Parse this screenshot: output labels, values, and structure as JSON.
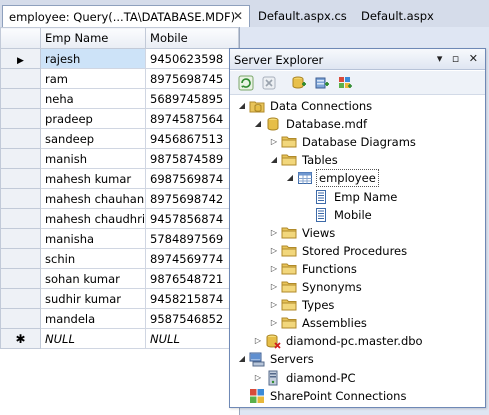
{
  "tabs": [
    {
      "label": "employee: Query(...TA\\DATABASE.MDF)",
      "active": true
    },
    {
      "label": "Default.aspx.cs",
      "active": false
    },
    {
      "label": "Default.aspx",
      "active": false
    }
  ],
  "tab_close_glyph": "✕",
  "grid": {
    "columns": [
      "Emp Name",
      "Mobile"
    ],
    "rows": [
      {
        "name": "rajesh",
        "mobile": "9450623598"
      },
      {
        "name": "ram",
        "mobile": "8975698745"
      },
      {
        "name": "neha",
        "mobile": "5689745895"
      },
      {
        "name": "pradeep",
        "mobile": "8974587564"
      },
      {
        "name": "sandeep",
        "mobile": "9456867513"
      },
      {
        "name": "manish",
        "mobile": "9875874589"
      },
      {
        "name": "mahesh kumar",
        "mobile": "6987569874"
      },
      {
        "name": "mahesh chauhan",
        "mobile": "8975698742"
      },
      {
        "name": "mahesh chaudhri",
        "mobile": "9457856874"
      },
      {
        "name": "manisha",
        "mobile": "5784897569"
      },
      {
        "name": "schin",
        "mobile": "8974569774"
      },
      {
        "name": "sohan kumar",
        "mobile": "9876548721"
      },
      {
        "name": "sudhir kumar",
        "mobile": "9458215874"
      },
      {
        "name": "mandela",
        "mobile": "9587546852"
      }
    ],
    "new_row": {
      "name": "NULL",
      "mobile": "NULL"
    },
    "current_row_glyph": "▶",
    "new_row_glyph": "✱"
  },
  "server_explorer": {
    "title": "Server Explorer",
    "title_buttons": "▾ ▫ ✕",
    "toolbar": [
      "refresh-icon",
      "stop-icon",
      "connect-to-database-icon",
      "connect-to-server-icon",
      "connect-to-sharepoint-icon"
    ],
    "tree": [
      {
        "label": "Data Connections",
        "depth": 0,
        "expander": "expanded",
        "icon": "data-connections-icon"
      },
      {
        "label": "Database.mdf",
        "depth": 1,
        "expander": "expanded",
        "icon": "database-icon"
      },
      {
        "label": "Database Diagrams",
        "depth": 2,
        "expander": "collapsed",
        "icon": "folder-icon"
      },
      {
        "label": "Tables",
        "depth": 2,
        "expander": "expanded",
        "icon": "folder-icon"
      },
      {
        "label": "employee",
        "depth": 3,
        "expander": "expanded",
        "icon": "table-icon",
        "boxed": true
      },
      {
        "label": "Emp Name",
        "depth": 4,
        "expander": "none",
        "icon": "column-icon"
      },
      {
        "label": "Mobile",
        "depth": 4,
        "expander": "none",
        "icon": "column-icon"
      },
      {
        "label": "Views",
        "depth": 2,
        "expander": "collapsed",
        "icon": "folder-icon"
      },
      {
        "label": "Stored Procedures",
        "depth": 2,
        "expander": "collapsed",
        "icon": "folder-icon"
      },
      {
        "label": "Functions",
        "depth": 2,
        "expander": "collapsed",
        "icon": "folder-icon"
      },
      {
        "label": "Synonyms",
        "depth": 2,
        "expander": "collapsed",
        "icon": "folder-icon"
      },
      {
        "label": "Types",
        "depth": 2,
        "expander": "collapsed",
        "icon": "folder-icon"
      },
      {
        "label": "Assemblies",
        "depth": 2,
        "expander": "collapsed",
        "icon": "folder-icon"
      },
      {
        "label": "diamond-pc.master.dbo",
        "depth": 1,
        "expander": "collapsed",
        "icon": "database-disconnected-icon"
      },
      {
        "label": "Servers",
        "depth": 0,
        "expander": "expanded",
        "icon": "servers-icon"
      },
      {
        "label": "diamond-PC",
        "depth": 1,
        "expander": "collapsed",
        "icon": "server-icon"
      },
      {
        "label": "SharePoint Connections",
        "depth": 0,
        "expander": "none",
        "icon": "sharepoint-icon"
      }
    ],
    "expander_glyphs": {
      "expanded": "◢",
      "collapsed": "▷",
      "none": ""
    }
  },
  "colors": {
    "selected_cell": "#cde3f8",
    "folder": "#e8c45a",
    "accent": "#6f89b6"
  }
}
